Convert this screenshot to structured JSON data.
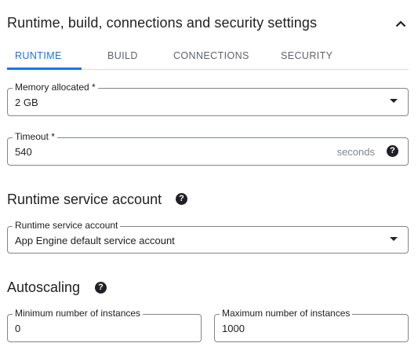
{
  "section": {
    "title": "Runtime, build, connections and security settings",
    "collapse_icon": "chevron-up-icon"
  },
  "tabs": [
    {
      "label": "RUNTIME",
      "active": true
    },
    {
      "label": "BUILD",
      "active": false
    },
    {
      "label": "CONNECTIONS",
      "active": false
    },
    {
      "label": "SECURITY",
      "active": false
    }
  ],
  "memory": {
    "label": "Memory allocated *",
    "value": "2 GB"
  },
  "timeout": {
    "label": "Timeout *",
    "value": "540",
    "suffix": "seconds",
    "help_icon": "help-icon"
  },
  "service_account": {
    "heading": "Runtime service account",
    "label": "Runtime service account",
    "value": "App Engine default service account"
  },
  "autoscaling": {
    "heading": "Autoscaling",
    "min_label": "Minimum number of instances",
    "min_value": "0",
    "max_label": "Maximum number of instances",
    "max_value": "1000"
  },
  "colors": {
    "accent": "#1a73e8",
    "text": "#202124",
    "muted": "#5f6368",
    "border": "#80868b"
  }
}
